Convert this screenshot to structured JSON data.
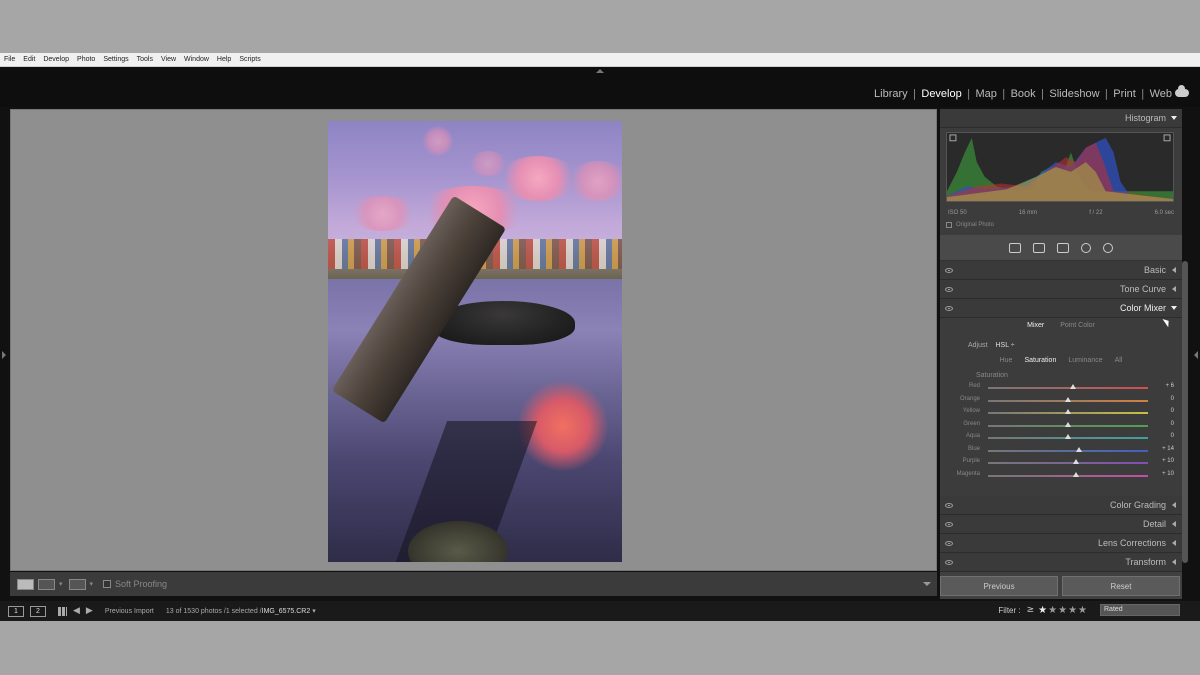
{
  "menubar": {
    "items": [
      "File",
      "Edit",
      "Develop",
      "Photo",
      "Settings",
      "Tools",
      "View",
      "Window",
      "Help",
      "Scripts"
    ]
  },
  "modules": {
    "items": [
      "Library",
      "Develop",
      "Map",
      "Book",
      "Slideshow",
      "Print",
      "Web"
    ],
    "active": "Develop",
    "cloud_icon": "cloud-icon"
  },
  "toolbar": {
    "soft_proofing": "Soft Proofing"
  },
  "filmstrip": {
    "view1": "1",
    "view2": "2",
    "source": "Previous Import",
    "count_text": "13 of 1530 photos /1 selected /",
    "filename": "IMG_6575.CR2",
    "filter_label": "Filter :",
    "filter_ge": "≥",
    "stars_on": 1,
    "stars_total": 5,
    "rated": "Rated"
  },
  "panel": {
    "histogram": {
      "title": "Histogram",
      "iso": "ISO 50",
      "focal": "16 mm",
      "aperture": "f / 22",
      "shutter": "6.0 sec",
      "original_photo": "Original Photo"
    },
    "sections": {
      "basic": "Basic",
      "tone_curve": "Tone Curve",
      "color_mixer": "Color Mixer",
      "color_grading": "Color Grading",
      "detail": "Detail",
      "lens_corrections": "Lens Corrections",
      "transform": "Transform"
    },
    "mixer": {
      "tab_mixer": "Mixer",
      "tab_point": "Point Color",
      "adjust_label": "Adjust",
      "adjust_value": "HSL ÷",
      "subtabs": [
        "Hue",
        "Saturation",
        "Luminance",
        "All"
      ],
      "active_subtab": "Saturation",
      "saturation_title": "Saturation",
      "sliders": [
        {
          "name": "Red",
          "value": "+ 6",
          "pos": 6,
          "color": "#d05050"
        },
        {
          "name": "Orange",
          "value": "0",
          "pos": 0,
          "color": "#d08040"
        },
        {
          "name": "Yellow",
          "value": "0",
          "pos": 0,
          "color": "#c8c040"
        },
        {
          "name": "Green",
          "value": "0",
          "pos": 0,
          "color": "#50a050"
        },
        {
          "name": "Aqua",
          "value": "0",
          "pos": 0,
          "color": "#40a0a0"
        },
        {
          "name": "Blue",
          "value": "+ 14",
          "pos": 14,
          "color": "#4060c0"
        },
        {
          "name": "Purple",
          "value": "+ 10",
          "pos": 10,
          "color": "#8050b0"
        },
        {
          "name": "Magenta",
          "value": "+ 10",
          "pos": 10,
          "color": "#c050a0"
        }
      ]
    },
    "buttons": {
      "previous": "Previous",
      "reset": "Reset"
    }
  }
}
